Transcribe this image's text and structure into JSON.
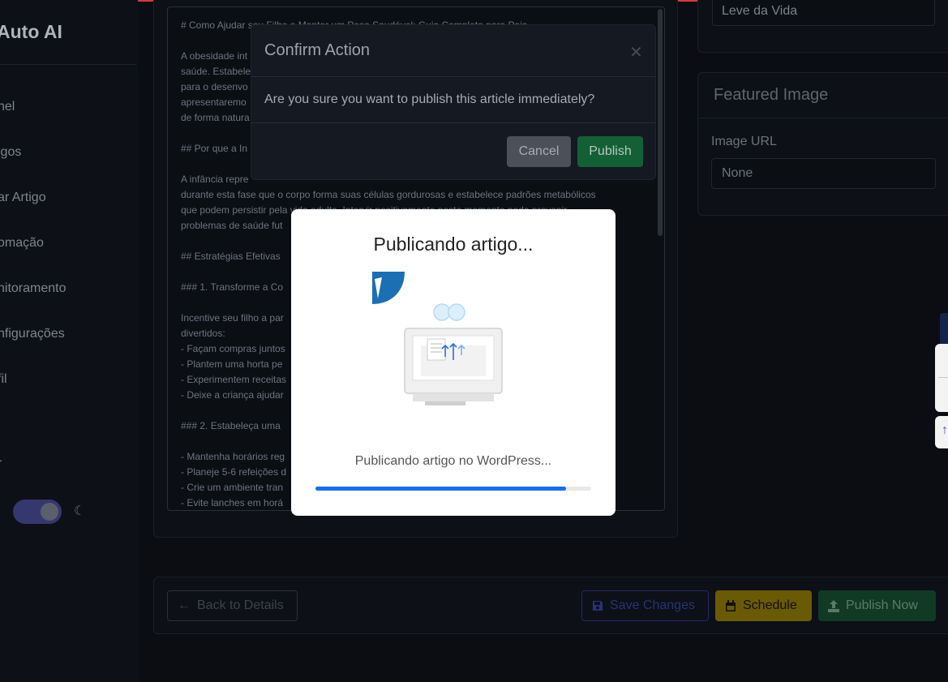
{
  "app": {
    "brand": "Auto AI"
  },
  "sidebar": {
    "items": [
      {
        "label": "nel"
      },
      {
        "label": "igos"
      },
      {
        "label": "ar Artigo"
      },
      {
        "label": "omação"
      },
      {
        "label": "nitoramento"
      },
      {
        "label": "nfigurações"
      },
      {
        "label": "fil"
      },
      {
        "label": "r"
      }
    ],
    "theme_toggle_on": true
  },
  "editor": {
    "content": "# Como Ajudar seu Filho a Manter um Peso Saudável: Guia Completo para Pais\n\nA obesidade int\nsaúde. Estabele\npara o desenvo\napresentaremo\nde forma natura\n\n## Por que a In\n\nA infância repre\ndurante esta fase que o corpo forma suas células gordurosas e estabelece padrões metabólicos\nque podem persistir pela vida adulta. Intervir positivamente neste momento pode prevenir\nproblemas de saúde fut\n\n## Estratégias Efetivas\n\n### 1. Transforme a Co\n\nIncentive seu filho a par\ndivertidos:\n- Façam compras juntos\n- Plantem uma horta pe\n- Experimentem receitas\n- Deixe a criança ajudar\n\n### 2. Estabeleça uma\n\n- Mantenha horários reg\n- Planeje 5-6 refeições d\n- Crie um ambiente tran\n- Evite lanches em horá"
  },
  "right_panel": {
    "tag_value": "Leve da Vida",
    "featured_image": {
      "title": "Featured Image",
      "url_label": "Image URL",
      "url_value": "None"
    }
  },
  "actions": {
    "back": "Back to Details",
    "save": "Save Changes",
    "schedule": "Schedule",
    "publish_now": "Publish Now"
  },
  "confirm_dialog": {
    "title": "Confirm Action",
    "message": "Are you sure you want to publish this article immediately?",
    "cancel": "Cancel",
    "publish": "Publish"
  },
  "progress_modal": {
    "title": "Publicando artigo...",
    "status": "Publicando artigo no WordPress...",
    "progress": 0.91
  },
  "colors": {
    "accent": "#1a6fe8",
    "success": "#136036",
    "warning": "#6a5a06",
    "danger_topline": "#d63a3a"
  }
}
